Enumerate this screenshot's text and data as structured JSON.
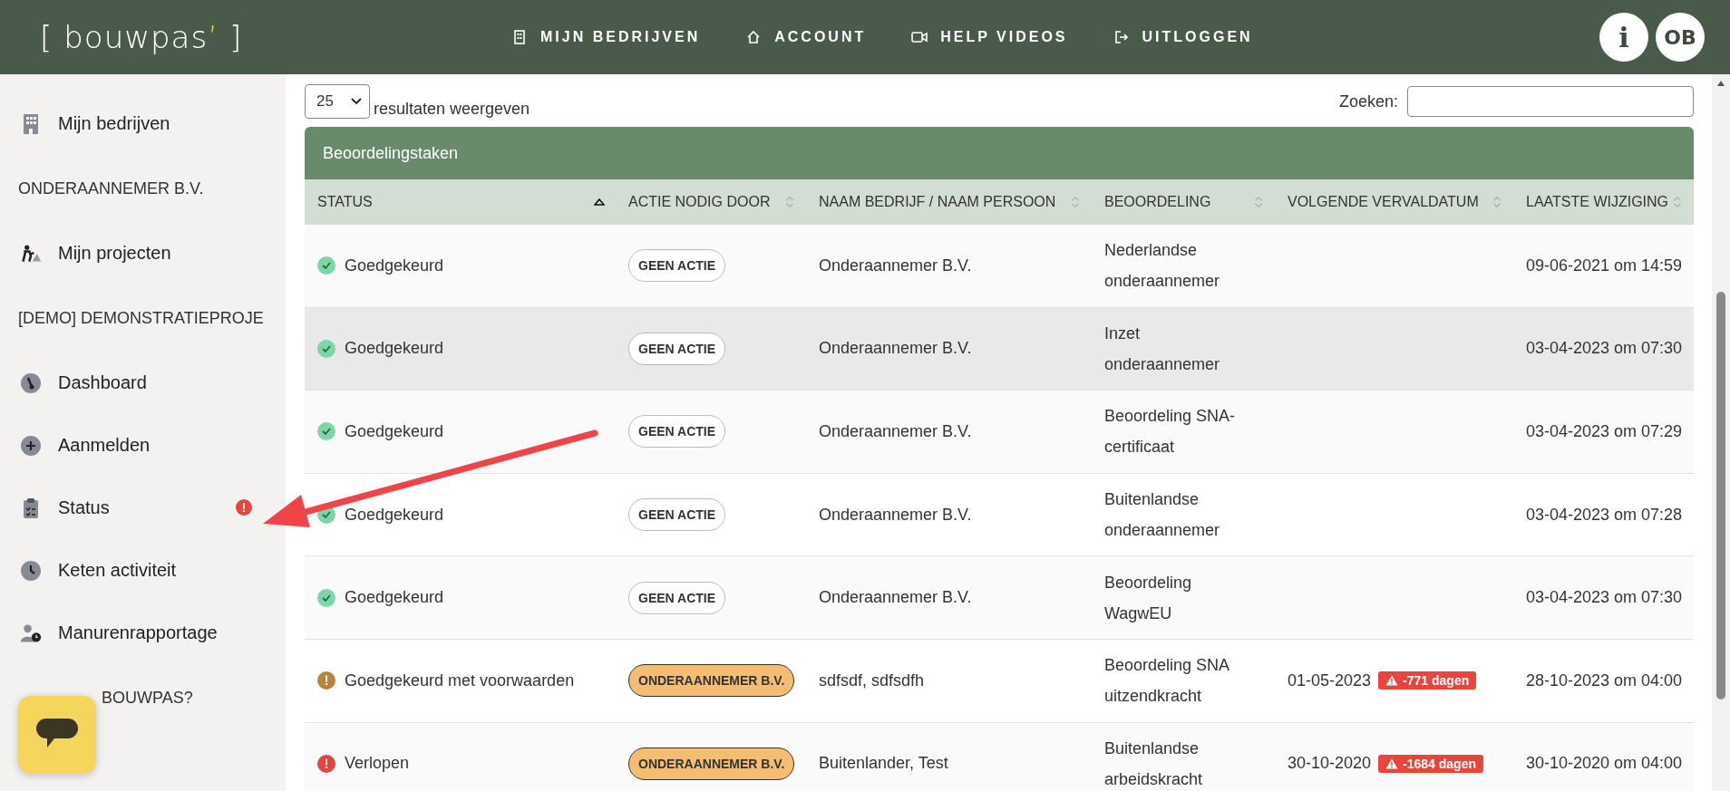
{
  "logo": {
    "open": "[",
    "name": "bouwpas",
    "accent": "’",
    "close": "]"
  },
  "nav": [
    {
      "label": "MIJN BEDRIJVEN"
    },
    {
      "label": "ACCOUNT"
    },
    {
      "label": "HELP VIDEOS"
    },
    {
      "label": "UITLOGGEN"
    }
  ],
  "avatars": [
    {
      "text": "i"
    },
    {
      "text": "OB"
    }
  ],
  "sidebar": {
    "items": [
      {
        "kind": "link",
        "label": "Mijn bedrijven",
        "alert": false
      },
      {
        "kind": "section",
        "label": "ONDERAANNEMER B.V."
      },
      {
        "kind": "link",
        "label": "Mijn projecten",
        "alert": false
      },
      {
        "kind": "section",
        "label": "[DEMO] DEMONSTRATIEPROJE"
      },
      {
        "kind": "link",
        "label": "Dashboard",
        "alert": false
      },
      {
        "kind": "link",
        "label": "Aanmelden",
        "alert": false
      },
      {
        "kind": "link",
        "label": "Status",
        "alert": true
      },
      {
        "kind": "link",
        "label": "Keten activiteit",
        "alert": false
      },
      {
        "kind": "link",
        "label": "Manurenrapportage",
        "alert": false
      },
      {
        "kind": "section",
        "label": "BOUWPAS?"
      }
    ]
  },
  "length_select": {
    "value": "25",
    "label": "resultaten weergeven"
  },
  "search": {
    "label": "Zoeken:"
  },
  "table": {
    "title": "Beoordelingstaken",
    "columns": [
      {
        "label": "STATUS",
        "sorted": true
      },
      {
        "label": "ACTIE NODIG DOOR",
        "sorted": false
      },
      {
        "label": "NAAM BEDRIJF / NAAM PERSOON",
        "sorted": false
      },
      {
        "label": "BEOORDELING",
        "sorted": false
      },
      {
        "label": "VOLGENDE VERVALDATUM",
        "sorted": false
      },
      {
        "label": "LAATSTE WIJZIGING",
        "sorted": false
      }
    ],
    "rows": [
      {
        "highlighted": false,
        "status": {
          "kind": "approved",
          "text": "Goedgekeurd"
        },
        "action": {
          "kind": "none",
          "text": "GEEN ACTIE"
        },
        "name": "Onderaannemer B.V.",
        "assessment": "Nederlandse onderaannemer",
        "modified": "09-06-2021 om 14:59"
      },
      {
        "highlighted": true,
        "status": {
          "kind": "approved",
          "text": "Goedgekeurd"
        },
        "action": {
          "kind": "none",
          "text": "GEEN ACTIE"
        },
        "name": "Onderaannemer B.V.",
        "assessment": "Inzet onderaannemer",
        "modified": "03-04-2023 om 07:30"
      },
      {
        "highlighted": false,
        "status": {
          "kind": "approved",
          "text": "Goedgekeurd"
        },
        "action": {
          "kind": "none",
          "text": "GEEN ACTIE"
        },
        "name": "Onderaannemer B.V.",
        "assessment": "Beoordeling SNA-certificaat",
        "modified": "03-04-2023 om 07:29"
      },
      {
        "highlighted": false,
        "status": {
          "kind": "approved",
          "text": "Goedgekeurd"
        },
        "action": {
          "kind": "none",
          "text": "GEEN ACTIE"
        },
        "name": "Onderaannemer B.V.",
        "assessment": "Buitenlandse onderaannemer",
        "modified": "03-04-2023 om 07:28"
      },
      {
        "highlighted": false,
        "status": {
          "kind": "approved",
          "text": "Goedgekeurd"
        },
        "action": {
          "kind": "none",
          "text": "GEEN ACTIE"
        },
        "name": "Onderaannemer B.V.",
        "assessment": "Beoordeling WagwEU",
        "modified": "03-04-2023 om 07:30"
      },
      {
        "highlighted": false,
        "status": {
          "kind": "conditional",
          "text": "Goedgekeurd met voorwaarden"
        },
        "action": {
          "kind": "party",
          "text": "ONDERAANNEMER B.V."
        },
        "name": "sdfsdf, sdfsdfh",
        "assessment": "Beoordeling SNA uitzendkracht",
        "due": "01-05-2023",
        "overdue": "-771 dagen",
        "modified": "28-10-2023 om 04:00"
      },
      {
        "highlighted": false,
        "status": {
          "kind": "expired",
          "text": "Verlopen"
        },
        "action": {
          "kind": "party",
          "text": "ONDERAANNEMER B.V."
        },
        "name": "Buitenlander, Test",
        "assessment": "Buitenlandse arbeidskracht",
        "due": "30-10-2020",
        "overdue": "-1684 dagen",
        "modified": "30-10-2020 om 04:00"
      }
    ]
  }
}
